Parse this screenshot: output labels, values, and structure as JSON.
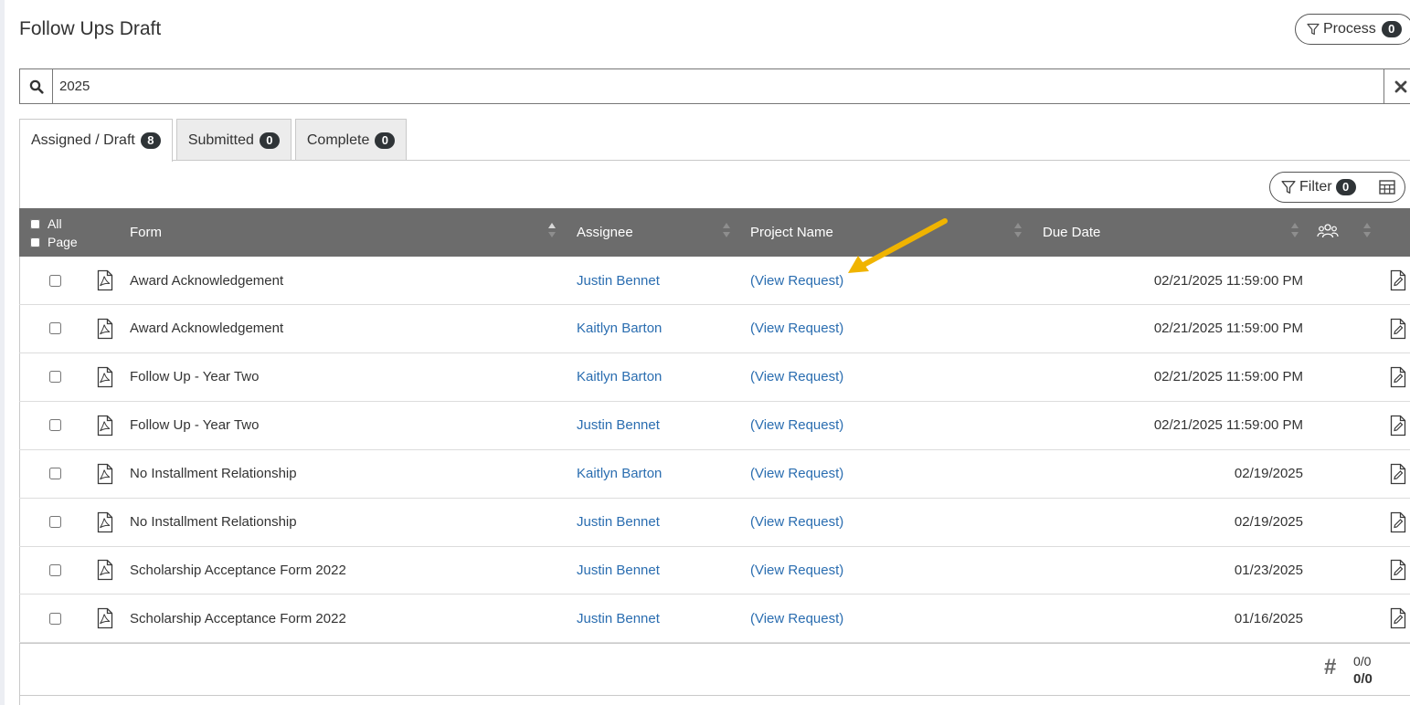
{
  "page": {
    "title": "Follow Ups Draft"
  },
  "process": {
    "label": "Process",
    "count": "0"
  },
  "search": {
    "value": "2025"
  },
  "tabs": [
    {
      "label": "Assigned / Draft",
      "count": "8"
    },
    {
      "label": "Submitted",
      "count": "0"
    },
    {
      "label": "Complete",
      "count": "0"
    }
  ],
  "filter": {
    "label": "Filter",
    "count": "0"
  },
  "table": {
    "headers": {
      "all": "All",
      "page": "Page",
      "form": "Form",
      "assignee": "Assignee",
      "project": "Project Name",
      "due": "Due Date"
    },
    "rows": [
      {
        "form": "Award Acknowledgement",
        "assignee": "Justin Bennet",
        "project": "(View Request)",
        "due": "02/21/2025 11:59:00 PM"
      },
      {
        "form": "Award Acknowledgement",
        "assignee": "Kaitlyn Barton",
        "project": "(View Request)",
        "due": "02/21/2025 11:59:00 PM"
      },
      {
        "form": "Follow Up - Year Two",
        "assignee": "Kaitlyn Barton",
        "project": "(View Request)",
        "due": "02/21/2025 11:59:00 PM"
      },
      {
        "form": "Follow Up - Year Two",
        "assignee": "Justin Bennet",
        "project": "(View Request)",
        "due": "02/21/2025 11:59:00 PM"
      },
      {
        "form": "No Installment Relationship",
        "assignee": "Kaitlyn Barton",
        "project": "(View Request)",
        "due": "02/19/2025"
      },
      {
        "form": "No Installment Relationship",
        "assignee": "Justin Bennet",
        "project": "(View Request)",
        "due": "02/19/2025"
      },
      {
        "form": "Scholarship Acceptance Form 2022",
        "assignee": "Justin Bennet",
        "project": "(View Request)",
        "due": "01/23/2025"
      },
      {
        "form": "Scholarship Acceptance Form 2022",
        "assignee": "Justin Bennet",
        "project": "(View Request)",
        "due": "01/16/2025"
      }
    ]
  },
  "pager": {
    "top": "0/0",
    "bottom": "0/0"
  },
  "colors": {
    "accent_link": "#2a6db0",
    "header_bg": "#6c6c6c",
    "annotation_arrow": "#f0b400"
  }
}
